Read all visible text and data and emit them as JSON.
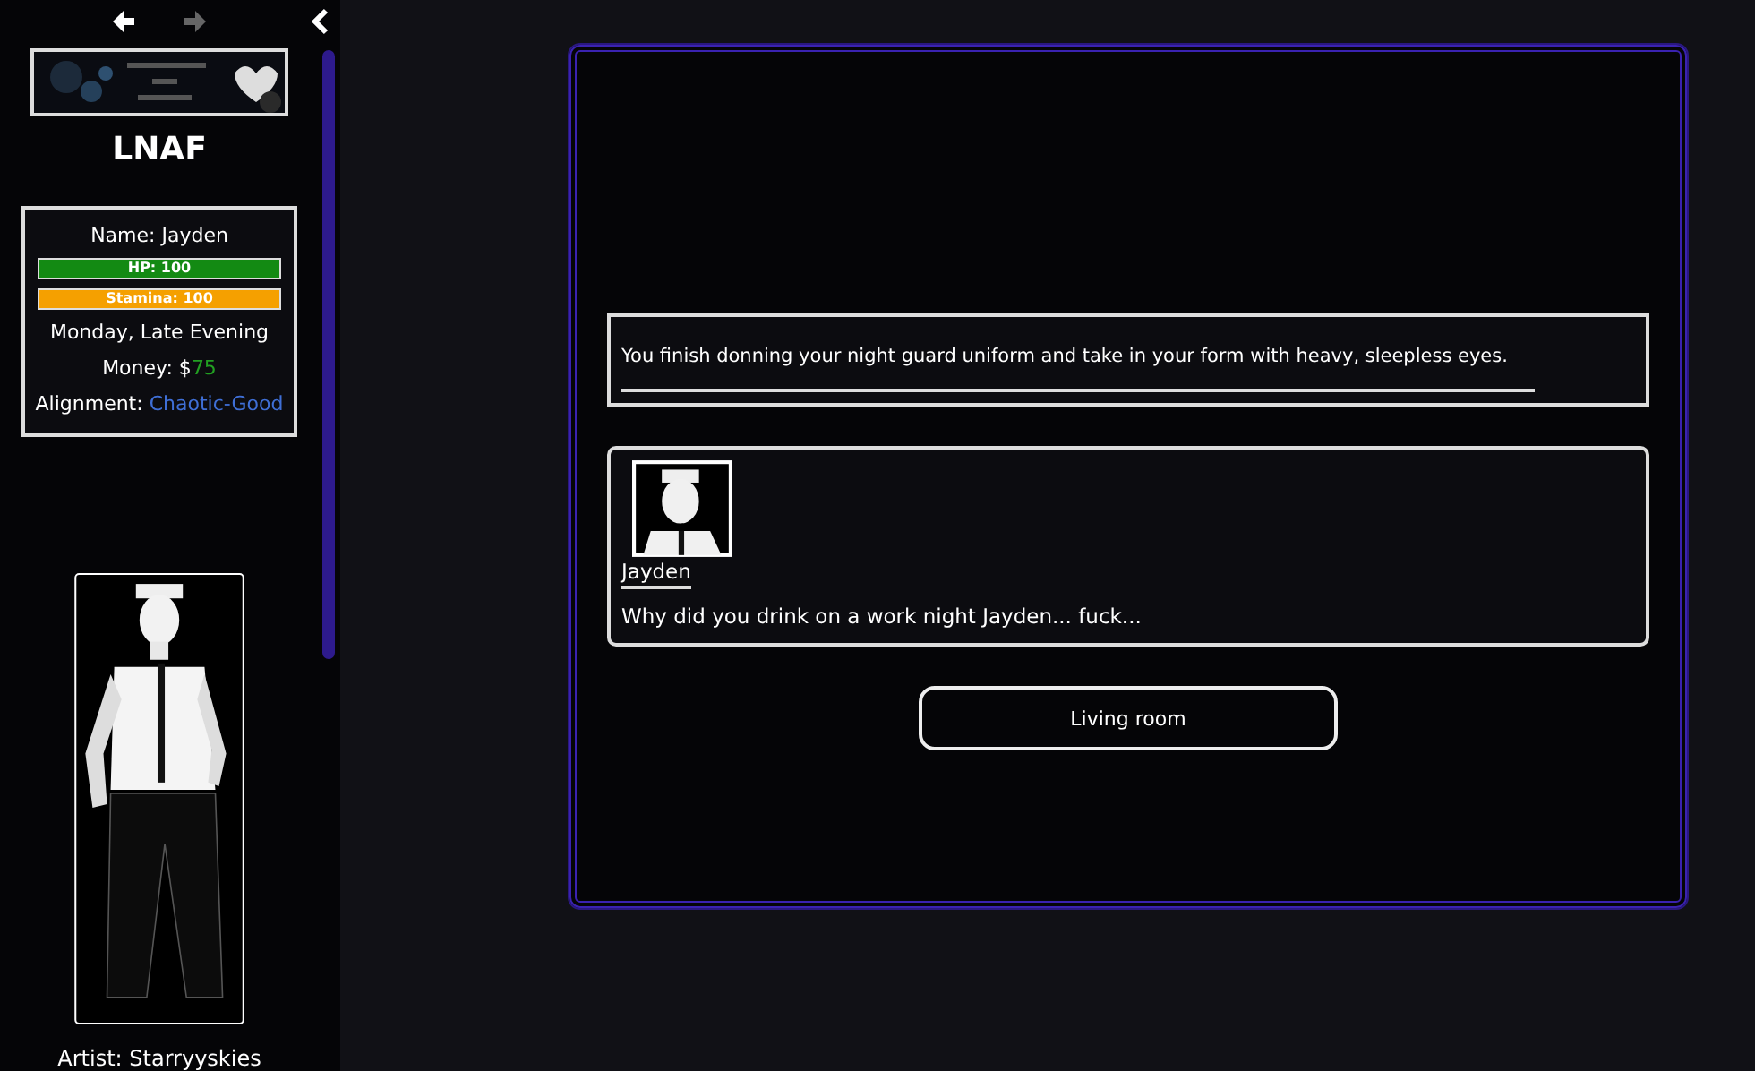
{
  "history": {
    "back": {
      "disabled": false
    },
    "forward": {
      "disabled": true
    }
  },
  "sidebar": {
    "title": "LNAF",
    "stats": {
      "name": "Name: Jayden",
      "bars": [
        {
          "label": "HP: 100",
          "level": 1,
          "color": "#138a13"
        },
        {
          "label": "Stamina: 100",
          "level": 1,
          "color": "#f5a000"
        }
      ],
      "time": "Monday, Late Evening",
      "money_label": "Money: $",
      "money_value": "75",
      "alignment_label": "Alignment: ",
      "alignment_value": "Chaotic-Good"
    },
    "credit": "Artist: Starryyskies"
  },
  "passage": {
    "narration": "You finish donning your night guard uniform and take in your form with heavy, sleepless eyes.",
    "dialogue": {
      "speaker": "Jayden",
      "line": "Why did you drink on a work night Jayden... fuck..."
    },
    "links": [
      "Living room"
    ]
  }
}
